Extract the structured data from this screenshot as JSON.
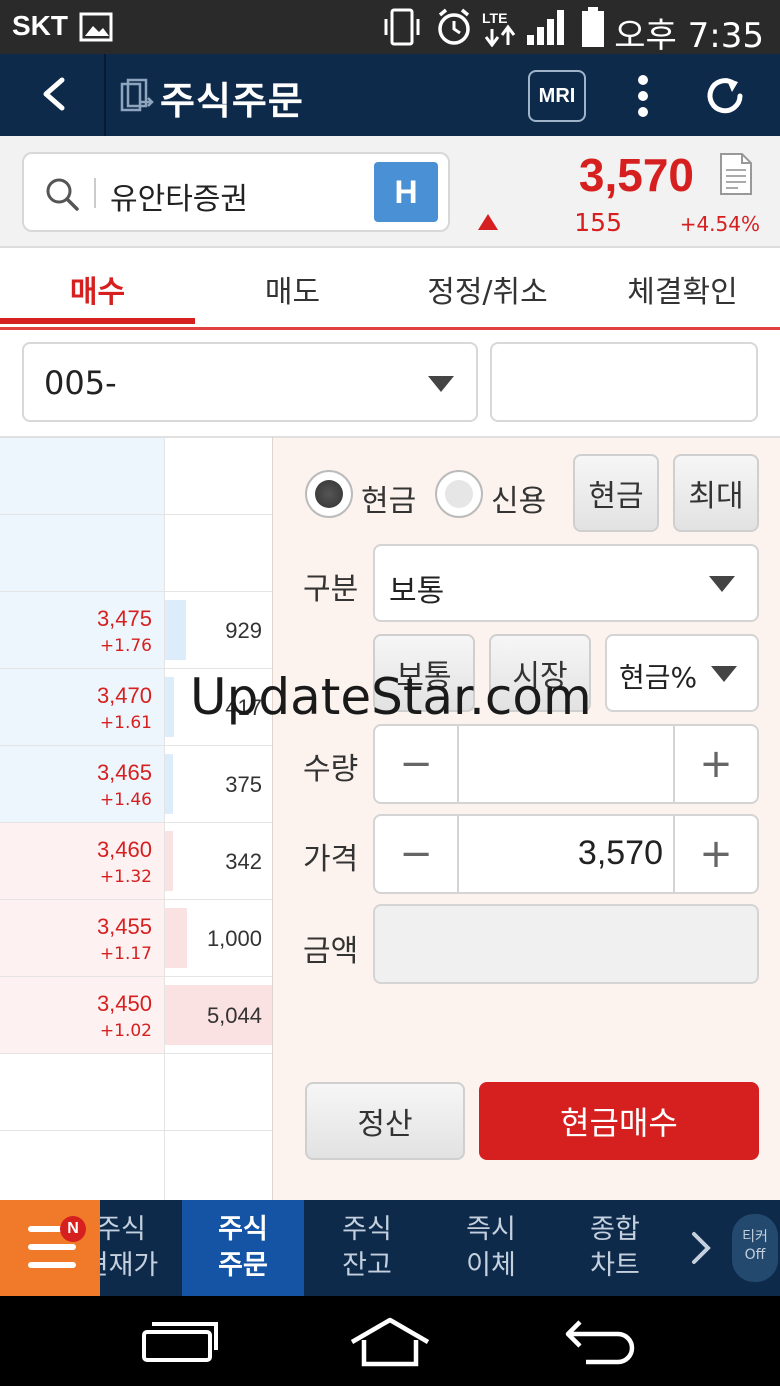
{
  "status_bar": {
    "carrier": "SKT",
    "time": "오후 7:35",
    "icons": [
      "gallery-icon",
      "vibrate-icon",
      "alarm-icon",
      "lte-icon",
      "signal-icon",
      "battery-icon"
    ]
  },
  "header": {
    "title": "주식주문",
    "mri_label": "MRI",
    "icons": [
      "back-arrow-icon",
      "document-icon",
      "more-vert-icon",
      "refresh-icon"
    ]
  },
  "stock": {
    "name": "유안타증권",
    "badge": "H",
    "price": "3,570",
    "change": "155",
    "change_pct": "+4.54%",
    "direction": "up"
  },
  "tabs": [
    {
      "label": "매수",
      "active": true
    },
    {
      "label": "매도",
      "active": false
    },
    {
      "label": "정정/취소",
      "active": false
    },
    {
      "label": "체결확인",
      "active": false
    }
  ],
  "account": {
    "number": "005-",
    "password_placeholder": ""
  },
  "order_book": [
    {
      "price": "3,475",
      "pct": "+1.76",
      "qty": "929",
      "bar": 0.19,
      "side": "ask"
    },
    {
      "price": "3,470",
      "pct": "+1.61",
      "qty": "417",
      "bar": 0.08,
      "side": "ask"
    },
    {
      "price": "3,465",
      "pct": "+1.46",
      "qty": "375",
      "bar": 0.07,
      "side": "ask"
    },
    {
      "price": "3,460",
      "pct": "+1.32",
      "qty": "342",
      "bar": 0.07,
      "side": "bid"
    },
    {
      "price": "3,455",
      "pct": "+1.17",
      "qty": "1,000",
      "bar": 0.2,
      "side": "bid"
    },
    {
      "price": "3,450",
      "pct": "+1.02",
      "qty": "5,044",
      "bar": 1.0,
      "side": "bid"
    }
  ],
  "form": {
    "radio_cash": "현금",
    "radio_credit": "신용",
    "btn_cash": "현금",
    "btn_max": "최대",
    "type_label": "구분",
    "type_value": "보통",
    "btn_normal": "보통",
    "btn_market": "시장",
    "cash_pct": "현금%",
    "qty_label": "수량",
    "qty_value": "",
    "price_label": "가격",
    "price_value": "3,570",
    "amount_label": "금액",
    "amount_value": "",
    "btn_settle": "정산",
    "btn_buy": "현금매수"
  },
  "watermark": "UpdateStar.com",
  "bottom_menu": {
    "badge": "N",
    "items": [
      {
        "line1": "주식",
        "line2": "현재가",
        "active": false
      },
      {
        "line1": "주식",
        "line2": "주문",
        "active": true
      },
      {
        "line1": "주식",
        "line2": "잔고",
        "active": false
      },
      {
        "line1": "즉시",
        "line2": "이체",
        "active": false
      },
      {
        "line1": "종합",
        "line2": "차트",
        "active": false
      }
    ],
    "ticker_line1": "티커",
    "ticker_line2": "Off"
  },
  "colors": {
    "header_bg": "#0e2a4b",
    "accent_red": "#d62020",
    "active_menu": "#1554a5",
    "menu_orange": "#f07a2a",
    "badge_blue": "#4a90d4"
  }
}
